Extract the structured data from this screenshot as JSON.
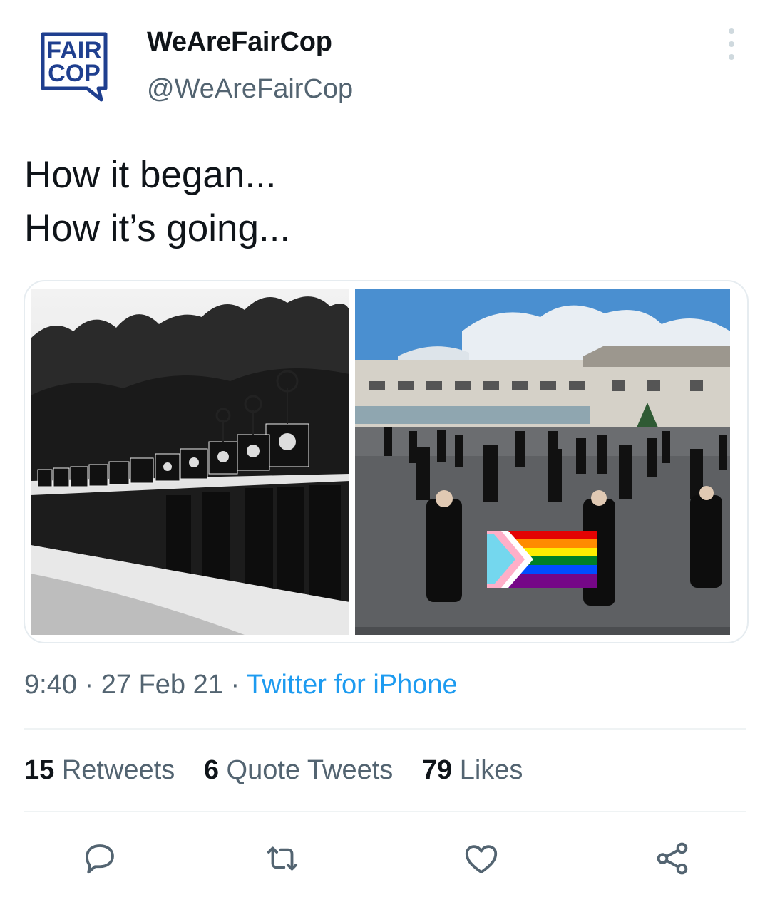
{
  "account": {
    "avatar_text_line1": "FAIR",
    "avatar_text_line2": "COP",
    "display_name": "WeAreFairCop",
    "handle": "@WeAreFairCop"
  },
  "tweet": {
    "lines": [
      "How it began...",
      "How it’s going..."
    ]
  },
  "meta": {
    "time": "9:40",
    "date": "27 Feb 21",
    "separator": " · ",
    "source": "Twitter for iPhone"
  },
  "stats": {
    "retweets_count": "15",
    "retweets_label": "Retweets",
    "quotes_count": "6",
    "quotes_label": "Quote Tweets",
    "likes_count": "79",
    "likes_label": "Likes"
  },
  "actions": [
    {
      "name": "reply",
      "icon": "reply-icon"
    },
    {
      "name": "retweet",
      "icon": "retweet-icon"
    },
    {
      "name": "like",
      "icon": "heart-icon"
    },
    {
      "name": "share",
      "icon": "share-icon"
    }
  ],
  "colors": {
    "text": "#0f1419",
    "secondary": "#536471",
    "link": "#1d9bf0",
    "brand": "#1f3f8f"
  }
}
